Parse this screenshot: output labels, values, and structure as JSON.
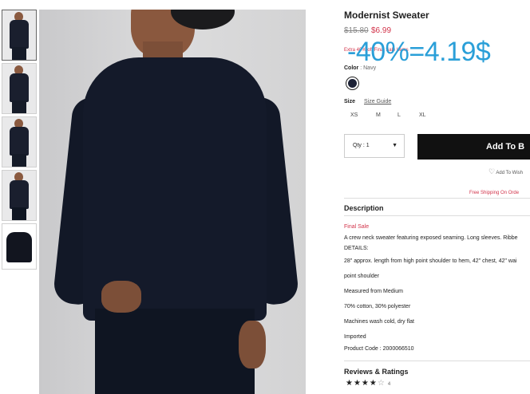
{
  "product": {
    "title": "Modernist Sweater",
    "old_price": "$15.80",
    "new_price": "$6.99",
    "promo_text": "Extra 40% off Final Sale Items",
    "overlay_text": "-40%=4.19$",
    "color_label": "Color",
    "color_value": ": Navy",
    "size_label": "Size",
    "size_guide": "Size Guide",
    "sizes": [
      "XS",
      "M",
      "L",
      "XL"
    ],
    "qty_label": "Qty : 1",
    "add_button": "Add To B",
    "wishlist": "Add To Wish",
    "shipping": "Free Shipping On Orde"
  },
  "description": {
    "title": "Description",
    "final_sale": "Final Sale",
    "lines": [
      "A crew neck sweater featuring exposed seaming. Long sleeves. Ribbe",
      "DETAILS:",
      "28\" approx. length from high point shoulder to hem, 42\" chest, 42\" wai",
      "point shoulder",
      "Measured from Medium",
      "70% cotton, 30% polyester",
      "Machines wash cold, dry flat",
      "Imported",
      "Product Code : 2000066510"
    ]
  },
  "reviews": {
    "title": "Reviews & Ratings",
    "rating": 4,
    "max": 5,
    "filled_stars": "★★★★",
    "empty_stars": "☆",
    "count": "4"
  },
  "colors": {
    "accent_red": "#d2334a",
    "overlay_blue": "#2a9fd8",
    "swatch_navy": "#1c2236"
  }
}
